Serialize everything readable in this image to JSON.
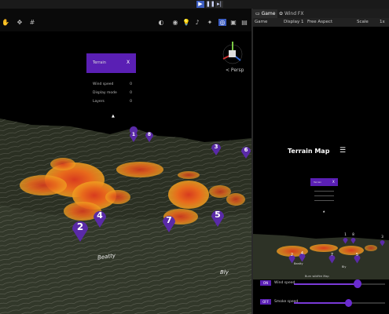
{
  "toolbar": {
    "play_icon": "play-icon",
    "pause_icon": "pause-icon",
    "step_icon": "step-icon"
  },
  "scene": {
    "perspective_label": "< Persp",
    "menu": {
      "title": "Terrain",
      "close": "X",
      "rows": [
        {
          "label": "Wind speed",
          "value": "0"
        },
        {
          "label": "Display mode",
          "value": "0"
        },
        {
          "label": "Layers",
          "value": "0"
        }
      ]
    },
    "pins": [
      "1",
      "8",
      "3",
      "6",
      "2",
      "4",
      "7",
      "5"
    ],
    "place_labels": [
      "Beatty",
      "Bly"
    ]
  },
  "game": {
    "tabs": [
      "Game",
      "Wind FX"
    ],
    "bar": {
      "mode": "Game",
      "display": "Display 1",
      "aspect": "Free Aspect",
      "scale_label": "Scale",
      "scale_value": "1x"
    },
    "title": "Terrain Map",
    "panel_title": "Terrain",
    "panel_close": "X",
    "pins": [
      "1",
      "8",
      "3",
      "2",
      "4",
      "7",
      "5"
    ],
    "place_labels": [
      "Beatty",
      "Bly"
    ],
    "banner": "Burn wildfire Map",
    "controls": [
      {
        "toggle": "ON",
        "label": "Wind speed",
        "fill": 0.7
      },
      {
        "toggle": "OFF",
        "label": "Smoke speed",
        "fill": 0.6
      }
    ]
  },
  "colors": {
    "accent": "#5a1fb4",
    "pin": "#5a2aa8",
    "play_active": "#3b5cc0",
    "heat_red": "#d83b1e",
    "heat_orange": "#f0a020"
  }
}
